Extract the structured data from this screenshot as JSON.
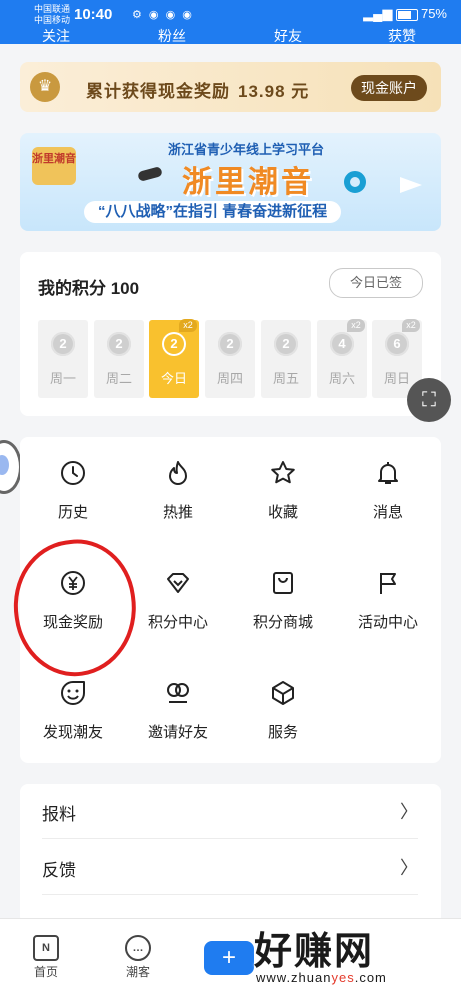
{
  "status_bar": {
    "carrier_1": "中国联通",
    "carrier_2": "中国移动",
    "time": "10:40",
    "battery": "75%"
  },
  "profile_stats": {
    "labels": [
      "关注",
      "粉丝",
      "好友",
      "获赞"
    ]
  },
  "cash_banner": {
    "text": "累计获得现金奖励",
    "amount": "13.98 元",
    "button": "现金账户"
  },
  "ad_banner": {
    "logo_text": "浙里潮音",
    "subtitle": "浙江省青少年线上学习平台",
    "title": "浙里潮音",
    "slogan": "“八八战略”在指引  青春奋进新征程"
  },
  "points": {
    "title": "我的积分 100",
    "signed_button": "今日已签",
    "days": [
      {
        "coin": "2",
        "label": "周一",
        "multiplier": "",
        "today": false
      },
      {
        "coin": "2",
        "label": "周二",
        "multiplier": "",
        "today": false
      },
      {
        "coin": "2",
        "label": "今日",
        "multiplier": "x2",
        "today": true
      },
      {
        "coin": "2",
        "label": "周四",
        "multiplier": "",
        "today": false
      },
      {
        "coin": "2",
        "label": "周五",
        "multiplier": "",
        "today": false
      },
      {
        "coin": "4",
        "label": "周六",
        "multiplier": "x2",
        "today": false
      },
      {
        "coin": "6",
        "label": "周日",
        "multiplier": "x2",
        "today": false
      }
    ]
  },
  "menu": {
    "items": [
      {
        "label": "历史",
        "icon": "clock-icon"
      },
      {
        "label": "热推",
        "icon": "flame-icon"
      },
      {
        "label": "收藏",
        "icon": "star-icon"
      },
      {
        "label": "消息",
        "icon": "bell-icon"
      },
      {
        "label": "现金奖励",
        "icon": "yen-icon"
      },
      {
        "label": "积分中心",
        "icon": "diamond-icon"
      },
      {
        "label": "积分商城",
        "icon": "shopping-bag-icon"
      },
      {
        "label": "活动中心",
        "icon": "flag-icon"
      },
      {
        "label": "发现潮友",
        "icon": "smile-icon"
      },
      {
        "label": "邀请好友",
        "icon": "invite-icon"
      },
      {
        "label": "服务",
        "icon": "cube-icon"
      }
    ]
  },
  "list": {
    "items": [
      {
        "label": "报料"
      },
      {
        "label": "反馈"
      }
    ]
  },
  "bottom_nav": {
    "items": [
      {
        "label": "首页",
        "icon": "home-news-icon"
      },
      {
        "label": "潮客",
        "icon": "chat-icon"
      }
    ],
    "plus_icon": "plus-icon"
  },
  "watermark": {
    "big": "好赚网",
    "url_prefix": "www.zhuan",
    "url_highlight": "yes",
    "url_suffix": ".com"
  },
  "colors": {
    "brand_blue": "#1f7cf0",
    "gold": "#f9c12e",
    "annotation_red": "#e01f1f"
  }
}
